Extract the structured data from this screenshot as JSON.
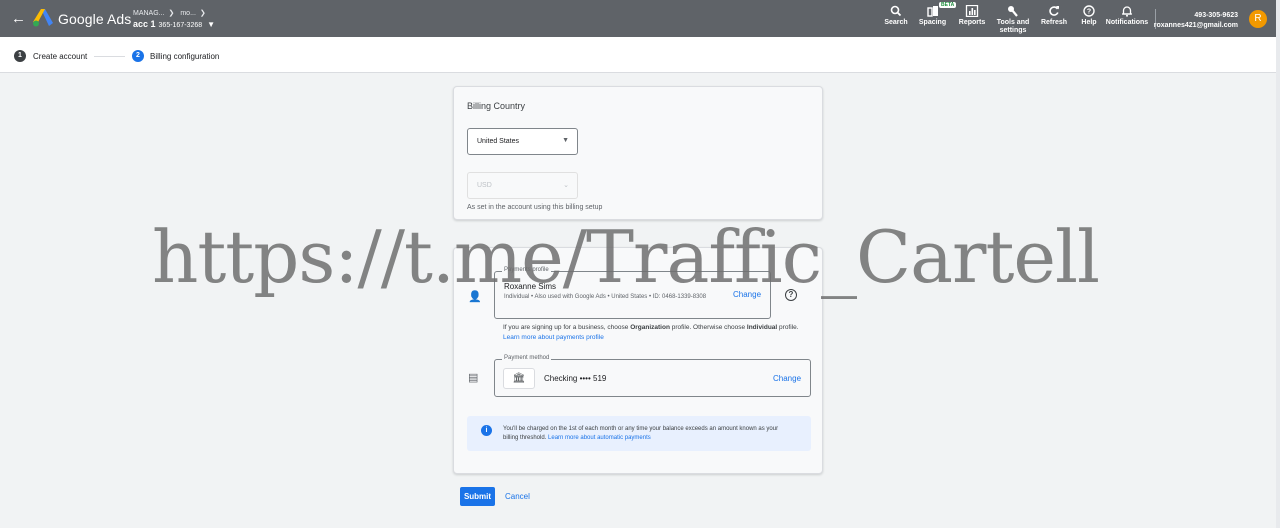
{
  "header": {
    "brand": "Google Ads",
    "breadcrumb": [
      "MANAG...",
      "mo..."
    ],
    "account_name": "acc 1",
    "account_number": "365-167-3268",
    "tools": [
      {
        "label": "Search",
        "icon": "search-icon"
      },
      {
        "label": "Spacing",
        "icon": "spacing-icon"
      },
      {
        "label": "Reports",
        "icon": "reports-icon"
      },
      {
        "label": "Tools and settings",
        "icon": "wrench-icon"
      },
      {
        "label": "Refresh",
        "icon": "refresh-icon"
      },
      {
        "label": "Help",
        "icon": "help-icon"
      },
      {
        "label": "Notifications",
        "icon": "bell-icon"
      }
    ],
    "beta_badge": "BETA",
    "customer_id": "493-305-9623",
    "email": "roxannes421@gmail.com",
    "avatar_letter": "R",
    "avatar_color": "#f29900"
  },
  "stepper": {
    "steps": [
      {
        "num": "1",
        "label": "Create account"
      },
      {
        "num": "2",
        "label": "Billing configuration"
      }
    ]
  },
  "billing_country": {
    "title": "Billing Country",
    "country": "United States",
    "currency": "USD",
    "currency_hint": "As set in the account using this billing setup"
  },
  "payments_profile": {
    "legend": "Payments profile",
    "name": "Roxanne Sims",
    "details": "Individual • Also used with Google Ads • United States • ID: 0468-1339-8308",
    "change": "Change",
    "note_pre": "If you are signing up for a business, choose ",
    "note_org": "Organization",
    "note_mid": " profile. Otherwise choose ",
    "note_ind": "Individual",
    "note_post": " profile. ",
    "note_link": "Learn more about payments profile"
  },
  "payment_method": {
    "legend": "Payment method",
    "label": "Checking •••• 519",
    "change": "Change"
  },
  "info": {
    "text": "You'll be charged on the 1st of each month or any time your balance exceeds an amount known as your billing threshold. ",
    "link": "Learn more about automatic payments"
  },
  "actions": {
    "submit": "Submit",
    "cancel": "Cancel"
  },
  "watermark": "https://t.me/Traffic_Cartell",
  "colors": {
    "topbar": "#5f6368",
    "accent": "#1a73e8"
  }
}
